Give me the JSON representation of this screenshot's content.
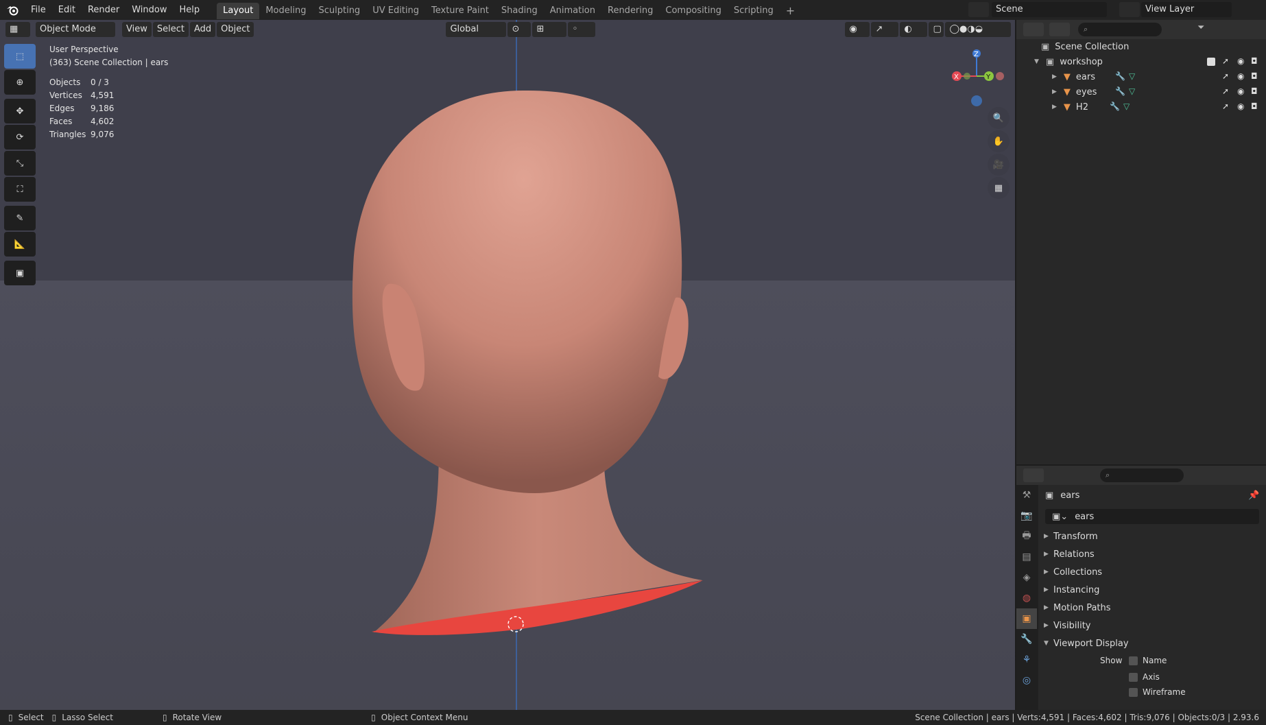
{
  "menu": {
    "file": "File",
    "edit": "Edit",
    "render": "Render",
    "window": "Window",
    "help": "Help"
  },
  "workspaces": [
    "Layout",
    "Modeling",
    "Sculpting",
    "UV Editing",
    "Texture Paint",
    "Shading",
    "Animation",
    "Rendering",
    "Compositing",
    "Scripting"
  ],
  "scene": {
    "label": "Scene",
    "view_layer": "View Layer"
  },
  "viewport_header": {
    "mode": "Object Mode",
    "view": "View",
    "select": "Select",
    "add": "Add",
    "object": "Object",
    "orientation": "Global"
  },
  "viewport": {
    "perspective": "User Perspective",
    "collection_info": "(363) Scene Collection | ears",
    "stats": [
      {
        "label": "Objects",
        "value": "0 / 3"
      },
      {
        "label": "Vertices",
        "value": "4,591"
      },
      {
        "label": "Edges",
        "value": "9,186"
      },
      {
        "label": "Faces",
        "value": "4,602"
      },
      {
        "label": "Triangles",
        "value": "9,076"
      }
    ],
    "gizmo": {
      "x": "X",
      "y": "Y",
      "z": "Z"
    }
  },
  "outliner": {
    "root": "Scene Collection",
    "collection": "workshop",
    "objects": [
      "ears",
      "eyes",
      "H2"
    ]
  },
  "properties": {
    "object_name": "ears",
    "field_name": "ears",
    "sections": [
      "Transform",
      "Relations",
      "Collections",
      "Instancing",
      "Motion Paths",
      "Visibility"
    ],
    "open_section": "Viewport Display",
    "show_label": "Show",
    "show_items": [
      "Name",
      "Axis",
      "Wireframe"
    ]
  },
  "statusbar": {
    "select": "Select",
    "lasso": "Lasso Select",
    "rotate": "Rotate View",
    "context": "Object Context Menu",
    "info": "Scene Collection | ears | Verts:4,591 | Faces:4,602 | Tris:9,076 | Objects:0/3 | 2.93.6"
  },
  "colors": {
    "accent": "#4772b3",
    "skin": "#c98979",
    "neck_cap": "#e8463f",
    "axis_x": "#e64a55",
    "axis_y": "#8cc63f",
    "axis_z": "#3e7ad6"
  }
}
